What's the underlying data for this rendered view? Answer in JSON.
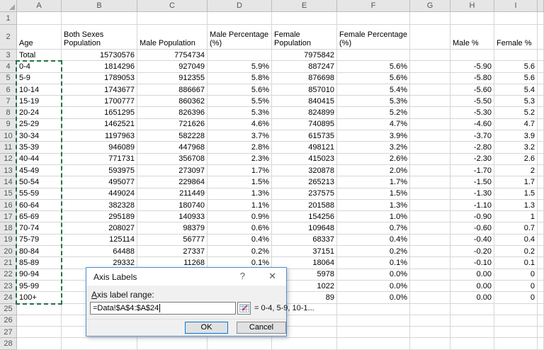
{
  "sheet": {
    "column_letters": [
      "A",
      "B",
      "C",
      "D",
      "E",
      "F",
      "G",
      "H",
      "I"
    ],
    "rows": [
      {
        "n": 1,
        "cells": [
          "",
          "",
          "",
          "",
          "",
          "",
          "",
          "",
          ""
        ]
      },
      {
        "n": 2,
        "cells": [
          "Age",
          "Both Sexes Population",
          "Male Population",
          "Male Percentage (%)",
          "Female Population",
          "Female Percentage (%)",
          "",
          "Male %",
          "Female %"
        ]
      },
      {
        "n": 3,
        "cells": [
          "Total",
          "15730576",
          "7754734",
          "",
          "7975842",
          "",
          "",
          "",
          ""
        ]
      },
      {
        "n": 4,
        "cells": [
          "0-4",
          "1814296",
          "927049",
          "5.9%",
          "887247",
          "5.6%",
          "",
          "-5.90",
          "5.6"
        ]
      },
      {
        "n": 5,
        "cells": [
          "5-9",
          "1789053",
          "912355",
          "5.8%",
          "876698",
          "5.6%",
          "",
          "-5.80",
          "5.6"
        ]
      },
      {
        "n": 6,
        "cells": [
          "10-14",
          "1743677",
          "886667",
          "5.6%",
          "857010",
          "5.4%",
          "",
          "-5.60",
          "5.4"
        ]
      },
      {
        "n": 7,
        "cells": [
          "15-19",
          "1700777",
          "860362",
          "5.5%",
          "840415",
          "5.3%",
          "",
          "-5.50",
          "5.3"
        ]
      },
      {
        "n": 8,
        "cells": [
          "20-24",
          "1651295",
          "826396",
          "5.3%",
          "824899",
          "5.2%",
          "",
          "-5.30",
          "5.2"
        ]
      },
      {
        "n": 9,
        "cells": [
          "25-29",
          "1462521",
          "721626",
          "4.6%",
          "740895",
          "4.7%",
          "",
          "-4.60",
          "4.7"
        ]
      },
      {
        "n": 10,
        "cells": [
          "30-34",
          "1197963",
          "582228",
          "3.7%",
          "615735",
          "3.9%",
          "",
          "-3.70",
          "3.9"
        ]
      },
      {
        "n": 11,
        "cells": [
          "35-39",
          "946089",
          "447968",
          "2.8%",
          "498121",
          "3.2%",
          "",
          "-2.80",
          "3.2"
        ]
      },
      {
        "n": 12,
        "cells": [
          "40-44",
          "771731",
          "356708",
          "2.3%",
          "415023",
          "2.6%",
          "",
          "-2.30",
          "2.6"
        ]
      },
      {
        "n": 13,
        "cells": [
          "45-49",
          "593975",
          "273097",
          "1.7%",
          "320878",
          "2.0%",
          "",
          "-1.70",
          "2"
        ]
      },
      {
        "n": 14,
        "cells": [
          "50-54",
          "495077",
          "229864",
          "1.5%",
          "265213",
          "1.7%",
          "",
          "-1.50",
          "1.7"
        ]
      },
      {
        "n": 15,
        "cells": [
          "55-59",
          "449024",
          "211449",
          "1.3%",
          "237575",
          "1.5%",
          "",
          "-1.30",
          "1.5"
        ]
      },
      {
        "n": 16,
        "cells": [
          "60-64",
          "382328",
          "180740",
          "1.1%",
          "201588",
          "1.3%",
          "",
          "-1.10",
          "1.3"
        ]
      },
      {
        "n": 17,
        "cells": [
          "65-69",
          "295189",
          "140933",
          "0.9%",
          "154256",
          "1.0%",
          "",
          "-0.90",
          "1"
        ]
      },
      {
        "n": 18,
        "cells": [
          "70-74",
          "208027",
          "98379",
          "0.6%",
          "109648",
          "0.7%",
          "",
          "-0.60",
          "0.7"
        ]
      },
      {
        "n": 19,
        "cells": [
          "75-79",
          "125114",
          "56777",
          "0.4%",
          "68337",
          "0.4%",
          "",
          "-0.40",
          "0.4"
        ]
      },
      {
        "n": 20,
        "cells": [
          "80-84",
          "64488",
          "27337",
          "0.2%",
          "37151",
          "0.2%",
          "",
          "-0.20",
          "0.2"
        ]
      },
      {
        "n": 21,
        "cells": [
          "85-89",
          "29332",
          "11268",
          "0.1%",
          "18064",
          "0.1%",
          "",
          "-0.10",
          "0.1"
        ]
      },
      {
        "n": 22,
        "cells": [
          "90-94",
          "",
          "",
          "",
          "5978",
          "0.0%",
          "",
          "0.00",
          "0"
        ]
      },
      {
        "n": 23,
        "cells": [
          "95-99",
          "",
          "",
          "",
          "1022",
          "0.0%",
          "",
          "0.00",
          "0"
        ]
      },
      {
        "n": 24,
        "cells": [
          "100+",
          "",
          "",
          "",
          "89",
          "0.0%",
          "",
          "0.00",
          "0"
        ]
      },
      {
        "n": 25,
        "cells": [
          "",
          "",
          "",
          "",
          "",
          "",
          "",
          "",
          ""
        ]
      },
      {
        "n": 26,
        "cells": [
          "",
          "",
          "",
          "",
          "",
          "",
          "",
          "",
          ""
        ]
      },
      {
        "n": 27,
        "cells": [
          "",
          "",
          "",
          "",
          "",
          "",
          "",
          "",
          ""
        ]
      },
      {
        "n": 28,
        "cells": [
          "",
          "",
          "",
          "",
          "",
          "",
          "",
          "",
          ""
        ]
      }
    ],
    "selected_range": "A4:A24"
  },
  "dialog": {
    "title": "Axis Labels",
    "help_icon": "?",
    "close_icon": "✕",
    "field_label_accel": "A",
    "field_label_rest": "xis label range:",
    "field_value": "=Data!$A$4:$A$24",
    "range_picker_icon": "range-selector",
    "range_preview": "= 0-4, 5-9, 10-1...",
    "ok_label": "OK",
    "cancel_label": "Cancel"
  },
  "colors": {
    "selection_green": "#217346",
    "dialog_border": "#4f8fd0",
    "ok_border": "#0078d7",
    "header_bg": "#e6e6e6"
  }
}
